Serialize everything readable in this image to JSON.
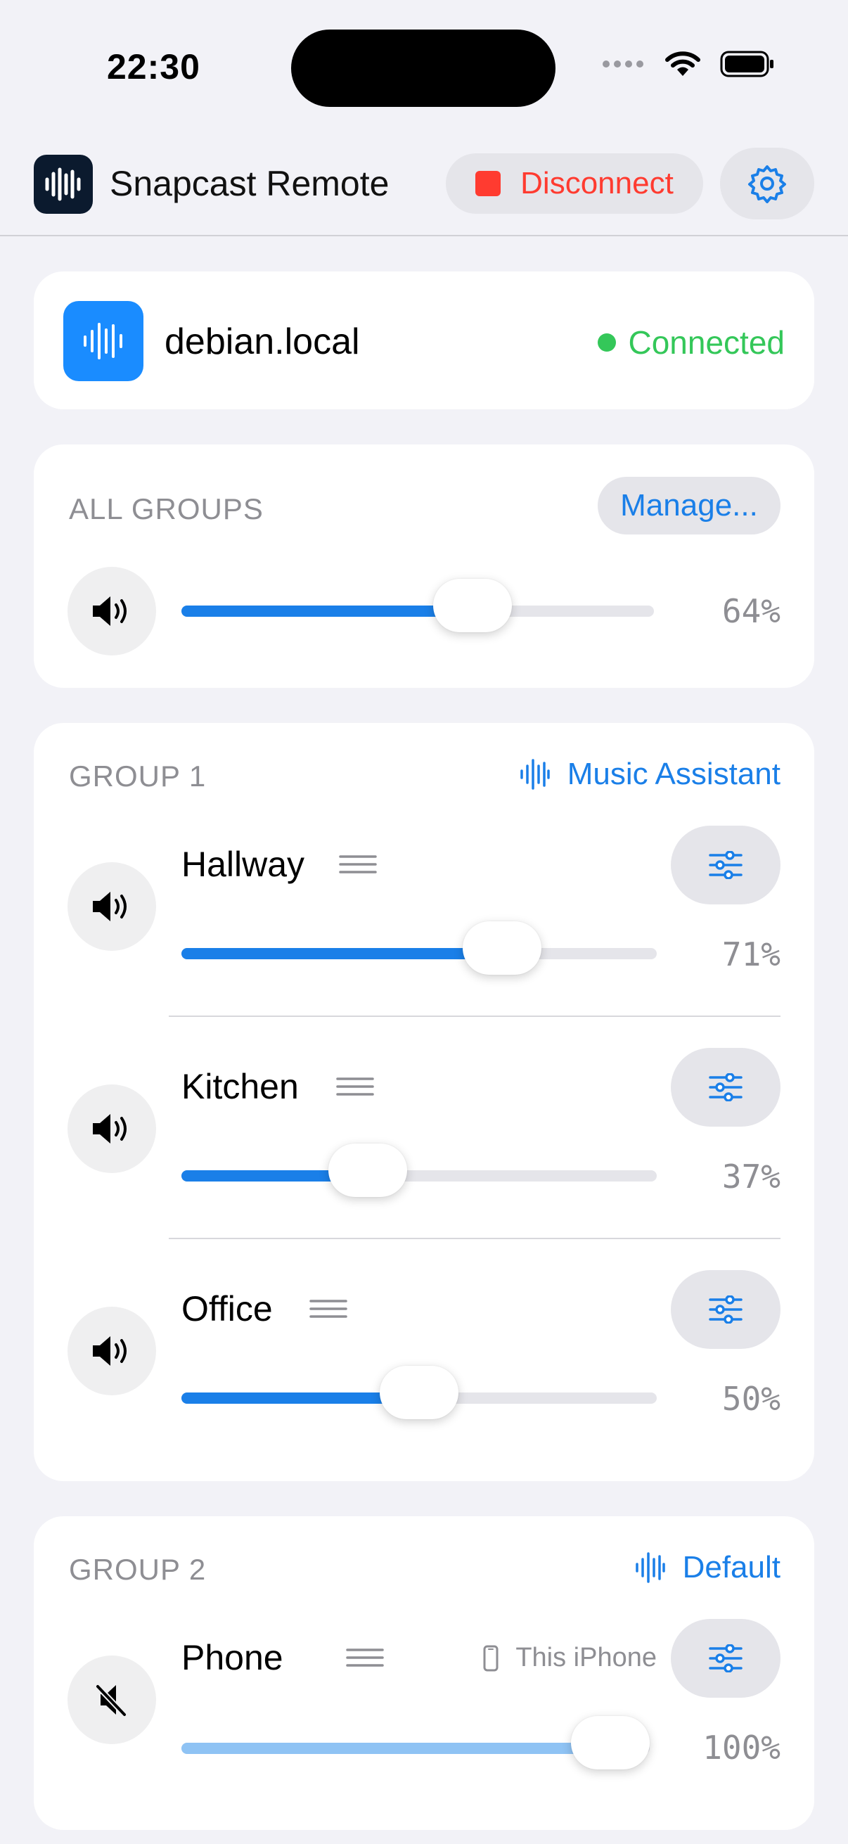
{
  "status_bar": {
    "time": "22:30"
  },
  "header": {
    "title": "Snapcast Remote",
    "disconnect_label": "Disconnect"
  },
  "server": {
    "name": "debian.local",
    "status": "Connected"
  },
  "all_groups": {
    "label": "ALL GROUPS",
    "manage_label": "Manage...",
    "volume": 64,
    "volume_text": "64%"
  },
  "groups": [
    {
      "label": "GROUP 1",
      "stream": "Music Assistant",
      "clients": [
        {
          "name": "Hallway",
          "volume": 71,
          "volume_text": "71%",
          "muted": false
        },
        {
          "name": "Kitchen",
          "volume": 37,
          "volume_text": "37%",
          "muted": false
        },
        {
          "name": "Office",
          "volume": 50,
          "volume_text": "50%",
          "muted": false
        }
      ]
    },
    {
      "label": "GROUP 2",
      "stream": "Default",
      "clients": [
        {
          "name": "Phone",
          "device_tag": "This iPhone",
          "volume": 100,
          "volume_text": "100%",
          "muted": true
        }
      ]
    }
  ],
  "colors": {
    "accent": "#1a7fe8",
    "danger": "#ff3b30",
    "success": "#34c759",
    "secondary_text": "#8e8e93"
  }
}
